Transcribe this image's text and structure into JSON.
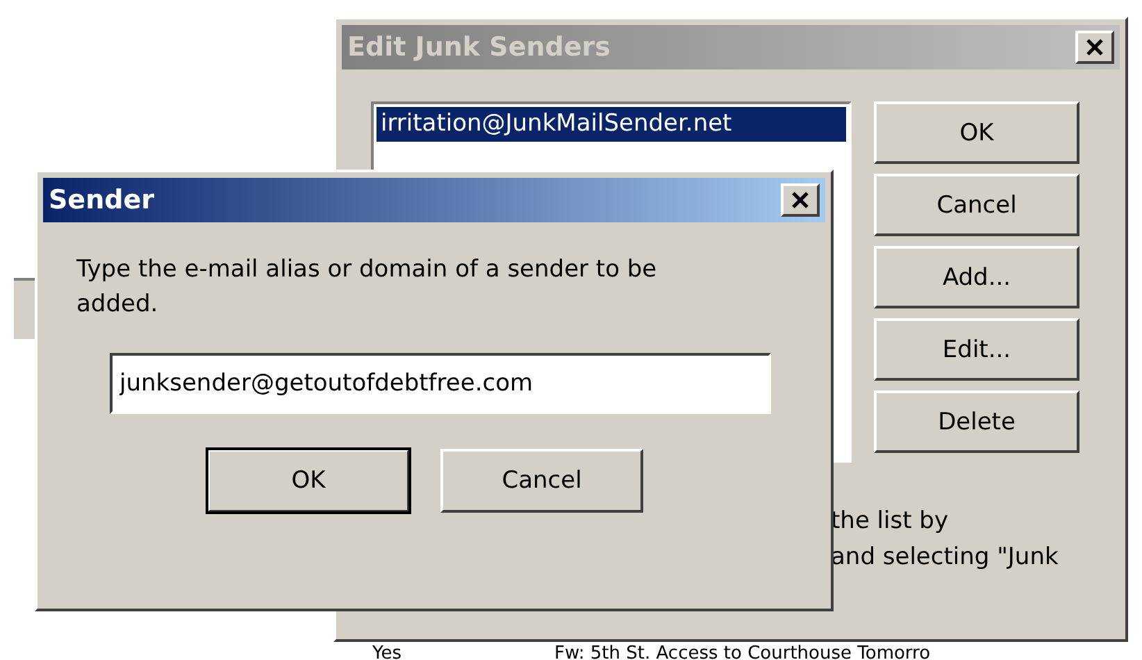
{
  "background": {
    "rows": [
      {
        "column_1": "Yes",
        "column_2": "Fw: 5th St. Access to Courthouse Tomorro"
      }
    ]
  },
  "edit_window": {
    "title": "Edit Junk Senders",
    "active": false,
    "senders": [
      {
        "address": "irritation@JunkMailSender.net",
        "selected": true
      }
    ],
    "buttons": [
      "OK",
      "Cancel",
      "Add...",
      "Edit...",
      "Delete"
    ],
    "hint_lines": [
      "the list by",
      "and selecting \"Junk"
    ]
  },
  "sender_dialog": {
    "title": "Sender",
    "active": true,
    "prompt": "Type the e-mail alias or domain of a sender to be added.",
    "field": {
      "value": "junksender@getoutofdebtfree.com"
    },
    "buttons": [
      {
        "label": "OK",
        "default": true
      },
      {
        "label": "Cancel",
        "default": false
      }
    ]
  }
}
